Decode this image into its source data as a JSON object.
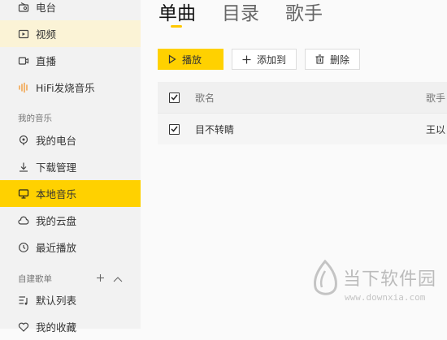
{
  "sidebar": {
    "items_top": [
      {
        "label": "电台",
        "icon": "radio-icon"
      },
      {
        "label": "视频",
        "icon": "video-icon"
      },
      {
        "label": "直播",
        "icon": "live-icon"
      },
      {
        "label": "HiFi发烧音乐",
        "icon": "hifi-wave-icon"
      }
    ],
    "section_my_music": "我的音乐",
    "items_my": [
      {
        "label": "我的电台",
        "icon": "my-radio-icon"
      },
      {
        "label": "下载管理",
        "icon": "download-icon"
      },
      {
        "label": "本地音乐",
        "icon": "monitor-icon"
      },
      {
        "label": "我的云盘",
        "icon": "cloud-icon"
      },
      {
        "label": "最近播放",
        "icon": "clock-icon"
      }
    ],
    "section_playlists": "自建歌单",
    "items_playlists": [
      {
        "label": "默认列表",
        "icon": "list-icon"
      },
      {
        "label": "我的收藏",
        "icon": "heart-icon"
      }
    ]
  },
  "tabs": [
    "单曲",
    "目录",
    "歌手"
  ],
  "toolbar": {
    "play": "播放",
    "add_to": "添加到",
    "delete": "删除"
  },
  "table": {
    "headers": {
      "name": "歌名",
      "singer": "歌手"
    },
    "rows": [
      {
        "name": "目不转睛",
        "singer": "王以"
      }
    ]
  },
  "watermark": {
    "text": "当下软件园",
    "url": "www.downxia.com"
  },
  "colors": {
    "accent": "#ffd100",
    "highlight": "#fbf3d6",
    "hifi_orange": "#f39c3d"
  }
}
